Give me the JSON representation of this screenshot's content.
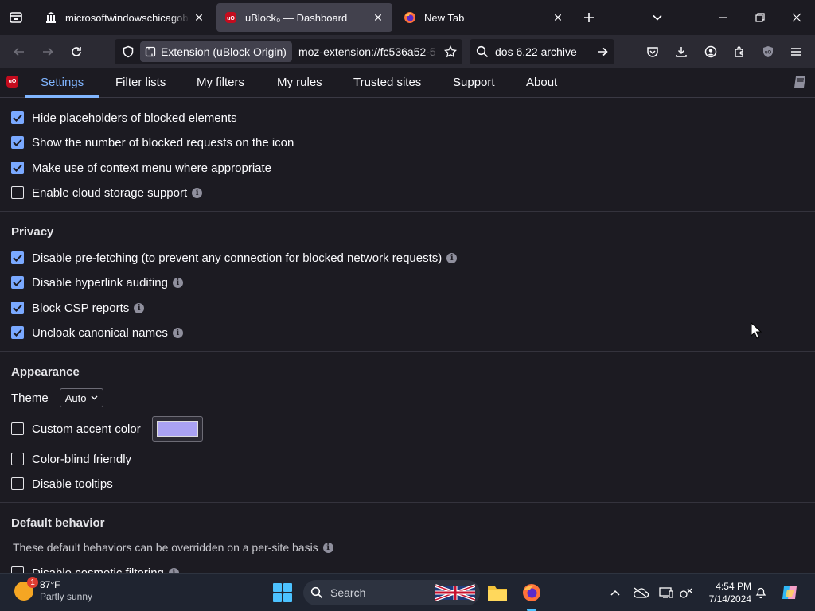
{
  "browser": {
    "tabs": [
      {
        "title": "microsoftwindowschicagobuild",
        "favicon": "archive-icon"
      },
      {
        "title": "uBlock₀ — Dashboard",
        "favicon": "ublock-icon"
      },
      {
        "title": "New Tab",
        "favicon": "firefox-icon"
      }
    ],
    "active_tab": 1,
    "url_identity": "Extension (uBlock Origin)",
    "url": "moz-extension://fc536a52-5",
    "search_query": "dos 6.22 archive"
  },
  "dashboard": {
    "logo_text": "uO",
    "tabs": [
      "Settings",
      "Filter lists",
      "My filters",
      "My rules",
      "Trusted sites",
      "Support",
      "About"
    ],
    "active": "Settings"
  },
  "settings": {
    "general": [
      {
        "label": "Hide placeholders of blocked elements",
        "checked": true
      },
      {
        "label": "Show the number of blocked requests on the icon",
        "checked": true
      },
      {
        "label": "Make use of context menu where appropriate",
        "checked": true
      },
      {
        "label": "Enable cloud storage support",
        "checked": false,
        "info": true
      }
    ],
    "privacy": {
      "title": "Privacy",
      "items": [
        {
          "label": "Disable pre-fetching (to prevent any connection for blocked network requests)",
          "checked": true,
          "info": true
        },
        {
          "label": "Disable hyperlink auditing",
          "checked": true,
          "info": true
        },
        {
          "label": "Block CSP reports",
          "checked": true,
          "info": true
        },
        {
          "label": "Uncloak canonical names",
          "checked": true,
          "info": true
        }
      ]
    },
    "appearance": {
      "title": "Appearance",
      "theme_label": "Theme",
      "theme_value": "Auto",
      "accent_label": "Custom accent color",
      "accent_checked": false,
      "accent_color": "#aaa2f3",
      "colorblind_label": "Color-blind friendly",
      "colorblind_checked": false,
      "tooltips_label": "Disable tooltips",
      "tooltips_checked": false
    },
    "default_behavior": {
      "title": "Default behavior",
      "note": "These default behaviors can be overridden on a per-site basis",
      "first_item": "Disable cosmetic filtering"
    }
  },
  "taskbar": {
    "weather_temp": "87°F",
    "weather_desc": "Partly sunny",
    "weather_badge": "1",
    "search_placeholder": "Search",
    "time": "4:54 PM",
    "date": "7/14/2024"
  },
  "colors": {
    "accent": "#80b5ff",
    "checkbox": "#7aa9ff",
    "background": "#1c1b22"
  }
}
